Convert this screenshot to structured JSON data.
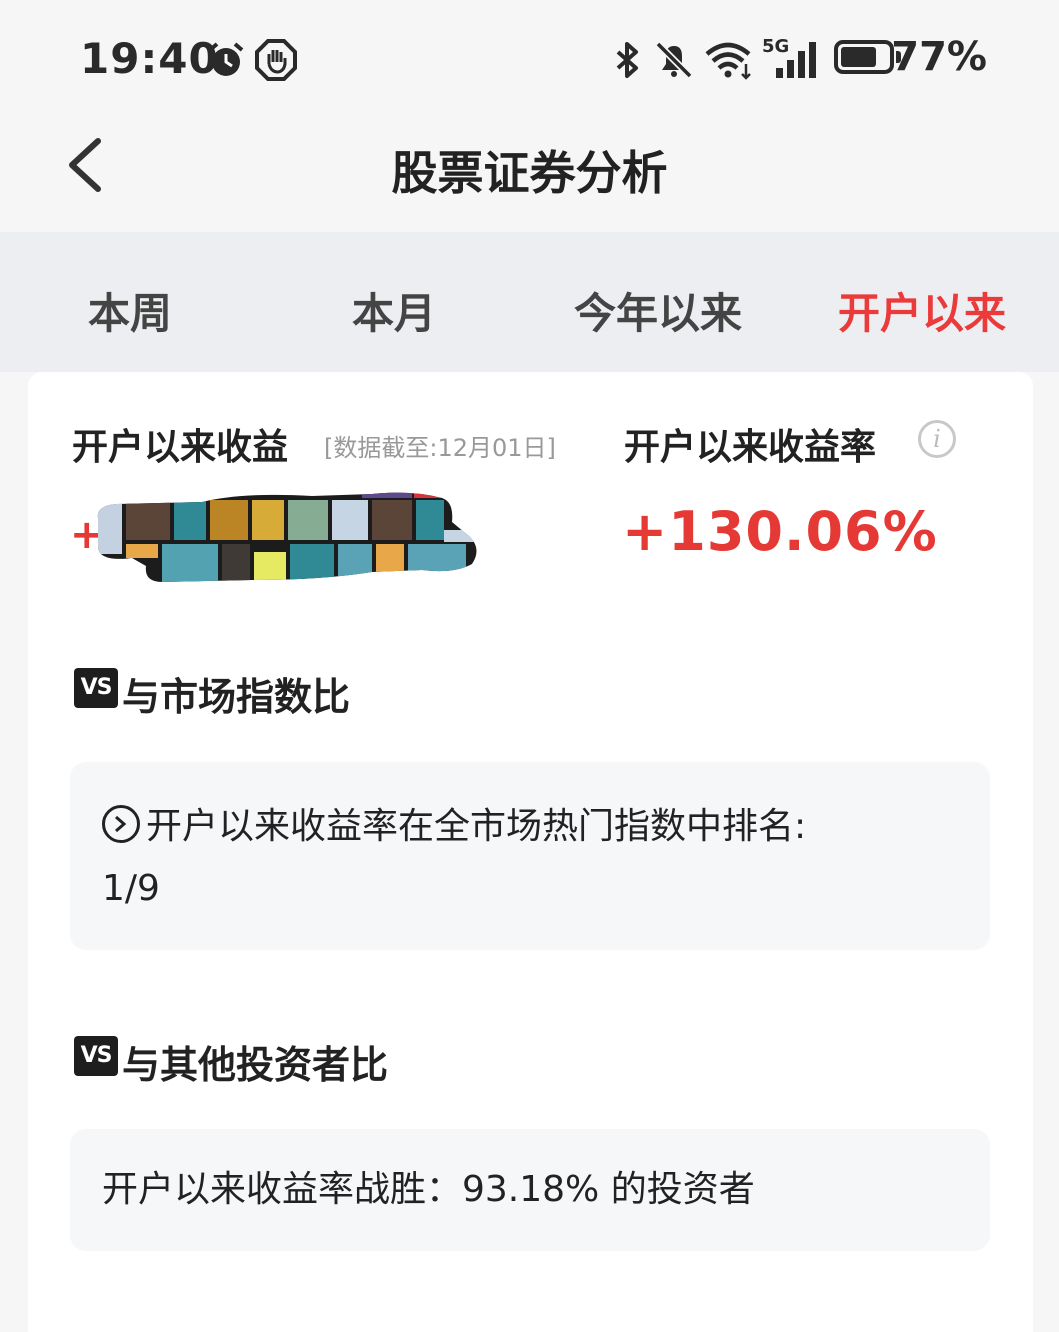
{
  "status_bar": {
    "time": "19:40",
    "icons": [
      "alarm-icon",
      "hand-icon",
      "bluetooth-icon",
      "mute-icon",
      "wifi-icon",
      "5g-signal-icon",
      "battery-icon"
    ],
    "signal_label": "5G",
    "battery": "77%",
    "battery_level": 0.77
  },
  "header": {
    "title": "股票证券分析"
  },
  "tabs": [
    {
      "label": "本周",
      "active": false
    },
    {
      "label": "本月",
      "active": false
    },
    {
      "label": "今年以来",
      "active": false
    },
    {
      "label": "开户以来",
      "active": true
    }
  ],
  "summary": {
    "profit_label": "开户以来收益",
    "date_note": "[数据截至:12月01日]",
    "profit_sign": "+",
    "rate_label": "开户以来收益率",
    "rate_value": "+130.06%"
  },
  "market_compare": {
    "badge": "VS",
    "title": "与市场指数比",
    "rank_text": "开户以来收益率在全市场热门指数中排名:",
    "rank_value": "1/9"
  },
  "investor_compare": {
    "badge": "VS",
    "title": "与其他投资者比",
    "text": "开户以来收益率战胜：93.18% 的投资者"
  },
  "colors": {
    "accent_red": "#e53935",
    "tab_active": "#ea3a3a"
  }
}
